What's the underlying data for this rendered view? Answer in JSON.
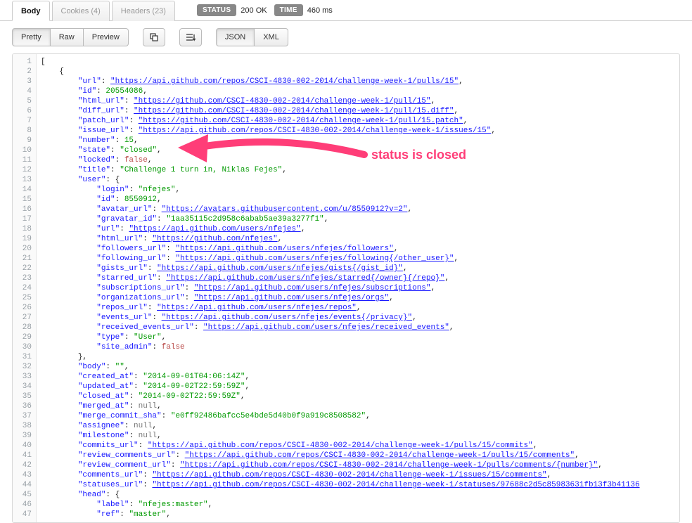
{
  "tabs": {
    "body": "Body",
    "cookies_label": "Cookies",
    "cookies_count": "(4)",
    "headers_label": "Headers",
    "headers_count": "(23)"
  },
  "status": {
    "status_label": "STATUS",
    "status_value": "200 OK",
    "time_label": "TIME",
    "time_value": "460 ms"
  },
  "toolbar": {
    "pretty": "Pretty",
    "raw": "Raw",
    "preview": "Preview",
    "json": "JSON",
    "xml": "XML"
  },
  "annotation": {
    "text": "status is closed"
  },
  "code": {
    "lines": [
      {
        "n": 1,
        "indent": 0,
        "tokens": [
          {
            "t": "p",
            "v": "["
          }
        ]
      },
      {
        "n": 2,
        "indent": 1,
        "tokens": [
          {
            "t": "p",
            "v": "{"
          }
        ]
      },
      {
        "n": 3,
        "indent": 2,
        "tokens": [
          {
            "t": "k",
            "v": "\"url\""
          },
          {
            "t": "p",
            "v": ": "
          },
          {
            "t": "u",
            "v": "\"https://api.github.com/repos/CSCI-4830-002-2014/challenge-week-1/pulls/15\""
          },
          {
            "t": "p",
            "v": ","
          }
        ]
      },
      {
        "n": 4,
        "indent": 2,
        "tokens": [
          {
            "t": "k",
            "v": "\"id\""
          },
          {
            "t": "p",
            "v": ": "
          },
          {
            "t": "s",
            "v": "20554086"
          },
          {
            "t": "p",
            "v": ","
          }
        ]
      },
      {
        "n": 5,
        "indent": 2,
        "tokens": [
          {
            "t": "k",
            "v": "\"html_url\""
          },
          {
            "t": "p",
            "v": ": "
          },
          {
            "t": "u",
            "v": "\"https://github.com/CSCI-4830-002-2014/challenge-week-1/pull/15\""
          },
          {
            "t": "p",
            "v": ","
          }
        ]
      },
      {
        "n": 6,
        "indent": 2,
        "tokens": [
          {
            "t": "k",
            "v": "\"diff_url\""
          },
          {
            "t": "p",
            "v": ": "
          },
          {
            "t": "u",
            "v": "\"https://github.com/CSCI-4830-002-2014/challenge-week-1/pull/15.diff\""
          },
          {
            "t": "p",
            "v": ","
          }
        ]
      },
      {
        "n": 7,
        "indent": 2,
        "tokens": [
          {
            "t": "k",
            "v": "\"patch_url\""
          },
          {
            "t": "p",
            "v": ": "
          },
          {
            "t": "u",
            "v": "\"https://github.com/CSCI-4830-002-2014/challenge-week-1/pull/15.patch\""
          },
          {
            "t": "p",
            "v": ","
          }
        ]
      },
      {
        "n": 8,
        "indent": 2,
        "tokens": [
          {
            "t": "k",
            "v": "\"issue_url\""
          },
          {
            "t": "p",
            "v": ": "
          },
          {
            "t": "u",
            "v": "\"https://api.github.com/repos/CSCI-4830-002-2014/challenge-week-1/issues/15\""
          },
          {
            "t": "p",
            "v": ","
          }
        ]
      },
      {
        "n": 9,
        "indent": 2,
        "tokens": [
          {
            "t": "k",
            "v": "\"number\""
          },
          {
            "t": "p",
            "v": ": "
          },
          {
            "t": "s",
            "v": "15"
          },
          {
            "t": "p",
            "v": ","
          }
        ]
      },
      {
        "n": 10,
        "indent": 2,
        "tokens": [
          {
            "t": "k",
            "v": "\"state\""
          },
          {
            "t": "p",
            "v": ": "
          },
          {
            "t": "s",
            "v": "\"closed\""
          },
          {
            "t": "p",
            "v": ","
          }
        ]
      },
      {
        "n": 11,
        "indent": 2,
        "tokens": [
          {
            "t": "k",
            "v": "\"locked\""
          },
          {
            "t": "p",
            "v": ": "
          },
          {
            "t": "false",
            "v": "false"
          },
          {
            "t": "p",
            "v": ","
          }
        ]
      },
      {
        "n": 12,
        "indent": 2,
        "tokens": [
          {
            "t": "k",
            "v": "\"title\""
          },
          {
            "t": "p",
            "v": ": "
          },
          {
            "t": "s",
            "v": "\"Challenge 1 turn in, Niklas Fejes\""
          },
          {
            "t": "p",
            "v": ","
          }
        ]
      },
      {
        "n": 13,
        "indent": 2,
        "tokens": [
          {
            "t": "k",
            "v": "\"user\""
          },
          {
            "t": "p",
            "v": ": {"
          }
        ]
      },
      {
        "n": 14,
        "indent": 3,
        "tokens": [
          {
            "t": "k",
            "v": "\"login\""
          },
          {
            "t": "p",
            "v": ": "
          },
          {
            "t": "s",
            "v": "\"nfejes\""
          },
          {
            "t": "p",
            "v": ","
          }
        ]
      },
      {
        "n": 15,
        "indent": 3,
        "tokens": [
          {
            "t": "k",
            "v": "\"id\""
          },
          {
            "t": "p",
            "v": ": "
          },
          {
            "t": "s",
            "v": "8550912"
          },
          {
            "t": "p",
            "v": ","
          }
        ]
      },
      {
        "n": 16,
        "indent": 3,
        "tokens": [
          {
            "t": "k",
            "v": "\"avatar_url\""
          },
          {
            "t": "p",
            "v": ": "
          },
          {
            "t": "u",
            "v": "\"https://avatars.githubusercontent.com/u/8550912?v=2\""
          },
          {
            "t": "p",
            "v": ","
          }
        ]
      },
      {
        "n": 17,
        "indent": 3,
        "tokens": [
          {
            "t": "k",
            "v": "\"gravatar_id\""
          },
          {
            "t": "p",
            "v": ": "
          },
          {
            "t": "s",
            "v": "\"1aa35115c2d958c6abab5ae39a3277f1\""
          },
          {
            "t": "p",
            "v": ","
          }
        ]
      },
      {
        "n": 18,
        "indent": 3,
        "tokens": [
          {
            "t": "k",
            "v": "\"url\""
          },
          {
            "t": "p",
            "v": ": "
          },
          {
            "t": "u",
            "v": "\"https://api.github.com/users/nfejes\""
          },
          {
            "t": "p",
            "v": ","
          }
        ]
      },
      {
        "n": 19,
        "indent": 3,
        "tokens": [
          {
            "t": "k",
            "v": "\"html_url\""
          },
          {
            "t": "p",
            "v": ": "
          },
          {
            "t": "u",
            "v": "\"https://github.com/nfejes\""
          },
          {
            "t": "p",
            "v": ","
          }
        ]
      },
      {
        "n": 20,
        "indent": 3,
        "tokens": [
          {
            "t": "k",
            "v": "\"followers_url\""
          },
          {
            "t": "p",
            "v": ": "
          },
          {
            "t": "u",
            "v": "\"https://api.github.com/users/nfejes/followers\""
          },
          {
            "t": "p",
            "v": ","
          }
        ]
      },
      {
        "n": 21,
        "indent": 3,
        "tokens": [
          {
            "t": "k",
            "v": "\"following_url\""
          },
          {
            "t": "p",
            "v": ": "
          },
          {
            "t": "u",
            "v": "\"https://api.github.com/users/nfejes/following{/other_user}\""
          },
          {
            "t": "p",
            "v": ","
          }
        ]
      },
      {
        "n": 22,
        "indent": 3,
        "tokens": [
          {
            "t": "k",
            "v": "\"gists_url\""
          },
          {
            "t": "p",
            "v": ": "
          },
          {
            "t": "u",
            "v": "\"https://api.github.com/users/nfejes/gists{/gist_id}\""
          },
          {
            "t": "p",
            "v": ","
          }
        ]
      },
      {
        "n": 23,
        "indent": 3,
        "tokens": [
          {
            "t": "k",
            "v": "\"starred_url\""
          },
          {
            "t": "p",
            "v": ": "
          },
          {
            "t": "u",
            "v": "\"https://api.github.com/users/nfejes/starred{/owner}{/repo}\""
          },
          {
            "t": "p",
            "v": ","
          }
        ]
      },
      {
        "n": 24,
        "indent": 3,
        "tokens": [
          {
            "t": "k",
            "v": "\"subscriptions_url\""
          },
          {
            "t": "p",
            "v": ": "
          },
          {
            "t": "u",
            "v": "\"https://api.github.com/users/nfejes/subscriptions\""
          },
          {
            "t": "p",
            "v": ","
          }
        ]
      },
      {
        "n": 25,
        "indent": 3,
        "tokens": [
          {
            "t": "k",
            "v": "\"organizations_url\""
          },
          {
            "t": "p",
            "v": ": "
          },
          {
            "t": "u",
            "v": "\"https://api.github.com/users/nfejes/orgs\""
          },
          {
            "t": "p",
            "v": ","
          }
        ]
      },
      {
        "n": 26,
        "indent": 3,
        "tokens": [
          {
            "t": "k",
            "v": "\"repos_url\""
          },
          {
            "t": "p",
            "v": ": "
          },
          {
            "t": "u",
            "v": "\"https://api.github.com/users/nfejes/repos\""
          },
          {
            "t": "p",
            "v": ","
          }
        ]
      },
      {
        "n": 27,
        "indent": 3,
        "tokens": [
          {
            "t": "k",
            "v": "\"events_url\""
          },
          {
            "t": "p",
            "v": ": "
          },
          {
            "t": "u",
            "v": "\"https://api.github.com/users/nfejes/events{/privacy}\""
          },
          {
            "t": "p",
            "v": ","
          }
        ]
      },
      {
        "n": 28,
        "indent": 3,
        "tokens": [
          {
            "t": "k",
            "v": "\"received_events_url\""
          },
          {
            "t": "p",
            "v": ": "
          },
          {
            "t": "u",
            "v": "\"https://api.github.com/users/nfejes/received_events\""
          },
          {
            "t": "p",
            "v": ","
          }
        ]
      },
      {
        "n": 29,
        "indent": 3,
        "tokens": [
          {
            "t": "k",
            "v": "\"type\""
          },
          {
            "t": "p",
            "v": ": "
          },
          {
            "t": "s",
            "v": "\"User\""
          },
          {
            "t": "p",
            "v": ","
          }
        ]
      },
      {
        "n": 30,
        "indent": 3,
        "tokens": [
          {
            "t": "k",
            "v": "\"site_admin\""
          },
          {
            "t": "p",
            "v": ": "
          },
          {
            "t": "false",
            "v": "false"
          }
        ]
      },
      {
        "n": 31,
        "indent": 2,
        "tokens": [
          {
            "t": "p",
            "v": "},"
          }
        ]
      },
      {
        "n": 32,
        "indent": 2,
        "tokens": [
          {
            "t": "k",
            "v": "\"body\""
          },
          {
            "t": "p",
            "v": ": "
          },
          {
            "t": "s",
            "v": "\"\""
          },
          {
            "t": "p",
            "v": ","
          }
        ]
      },
      {
        "n": 33,
        "indent": 2,
        "tokens": [
          {
            "t": "k",
            "v": "\"created_at\""
          },
          {
            "t": "p",
            "v": ": "
          },
          {
            "t": "s",
            "v": "\"2014-09-01T04:06:14Z\""
          },
          {
            "t": "p",
            "v": ","
          }
        ]
      },
      {
        "n": 34,
        "indent": 2,
        "tokens": [
          {
            "t": "k",
            "v": "\"updated_at\""
          },
          {
            "t": "p",
            "v": ": "
          },
          {
            "t": "s",
            "v": "\"2014-09-02T22:59:59Z\""
          },
          {
            "t": "p",
            "v": ","
          }
        ]
      },
      {
        "n": 35,
        "indent": 2,
        "tokens": [
          {
            "t": "k",
            "v": "\"closed_at\""
          },
          {
            "t": "p",
            "v": ": "
          },
          {
            "t": "s",
            "v": "\"2014-09-02T22:59:59Z\""
          },
          {
            "t": "p",
            "v": ","
          }
        ]
      },
      {
        "n": 36,
        "indent": 2,
        "tokens": [
          {
            "t": "k",
            "v": "\"merged_at\""
          },
          {
            "t": "p",
            "v": ": "
          },
          {
            "t": "null",
            "v": "null"
          },
          {
            "t": "p",
            "v": ","
          }
        ]
      },
      {
        "n": 37,
        "indent": 2,
        "tokens": [
          {
            "t": "k",
            "v": "\"merge_commit_sha\""
          },
          {
            "t": "p",
            "v": ": "
          },
          {
            "t": "s",
            "v": "\"e0ff92486bafcc5e4bde5d40b0f9a919c8508582\""
          },
          {
            "t": "p",
            "v": ","
          }
        ]
      },
      {
        "n": 38,
        "indent": 2,
        "tokens": [
          {
            "t": "k",
            "v": "\"assignee\""
          },
          {
            "t": "p",
            "v": ": "
          },
          {
            "t": "null",
            "v": "null"
          },
          {
            "t": "p",
            "v": ","
          }
        ]
      },
      {
        "n": 39,
        "indent": 2,
        "tokens": [
          {
            "t": "k",
            "v": "\"milestone\""
          },
          {
            "t": "p",
            "v": ": "
          },
          {
            "t": "null",
            "v": "null"
          },
          {
            "t": "p",
            "v": ","
          }
        ]
      },
      {
        "n": 40,
        "indent": 2,
        "tokens": [
          {
            "t": "k",
            "v": "\"commits_url\""
          },
          {
            "t": "p",
            "v": ": "
          },
          {
            "t": "u",
            "v": "\"https://api.github.com/repos/CSCI-4830-002-2014/challenge-week-1/pulls/15/commits\""
          },
          {
            "t": "p",
            "v": ","
          }
        ]
      },
      {
        "n": 41,
        "indent": 2,
        "tokens": [
          {
            "t": "k",
            "v": "\"review_comments_url\""
          },
          {
            "t": "p",
            "v": ": "
          },
          {
            "t": "u",
            "v": "\"https://api.github.com/repos/CSCI-4830-002-2014/challenge-week-1/pulls/15/comments\""
          },
          {
            "t": "p",
            "v": ","
          }
        ]
      },
      {
        "n": 42,
        "indent": 2,
        "tokens": [
          {
            "t": "k",
            "v": "\"review_comment_url\""
          },
          {
            "t": "p",
            "v": ": "
          },
          {
            "t": "u",
            "v": "\"https://api.github.com/repos/CSCI-4830-002-2014/challenge-week-1/pulls/comments/{number}\""
          },
          {
            "t": "p",
            "v": ","
          }
        ]
      },
      {
        "n": 43,
        "indent": 2,
        "tokens": [
          {
            "t": "k",
            "v": "\"comments_url\""
          },
          {
            "t": "p",
            "v": ": "
          },
          {
            "t": "u",
            "v": "\"https://api.github.com/repos/CSCI-4830-002-2014/challenge-week-1/issues/15/comments\""
          },
          {
            "t": "p",
            "v": ","
          }
        ]
      },
      {
        "n": 44,
        "indent": 2,
        "tokens": [
          {
            "t": "k",
            "v": "\"statuses_url\""
          },
          {
            "t": "p",
            "v": ": "
          },
          {
            "t": "u",
            "v": "\"https://api.github.com/repos/CSCI-4830-002-2014/challenge-week-1/statuses/97688c2d5c85983631fb13f3b41136"
          }
        ]
      },
      {
        "n": 45,
        "indent": 2,
        "tokens": [
          {
            "t": "k",
            "v": "\"head\""
          },
          {
            "t": "p",
            "v": ": {"
          }
        ]
      },
      {
        "n": 46,
        "indent": 3,
        "tokens": [
          {
            "t": "k",
            "v": "\"label\""
          },
          {
            "t": "p",
            "v": ": "
          },
          {
            "t": "s",
            "v": "\"nfejes:master\""
          },
          {
            "t": "p",
            "v": ","
          }
        ]
      },
      {
        "n": 47,
        "indent": 3,
        "tokens": [
          {
            "t": "k",
            "v": "\"ref\""
          },
          {
            "t": "p",
            "v": ": "
          },
          {
            "t": "s",
            "v": "\"master\""
          },
          {
            "t": "p",
            "v": ","
          }
        ]
      }
    ]
  }
}
